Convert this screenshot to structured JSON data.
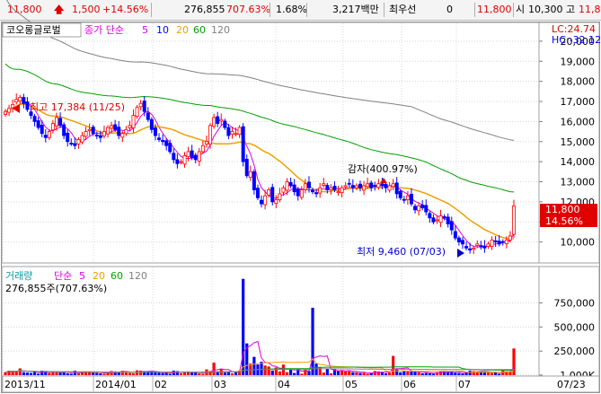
{
  "topbar": {
    "price": "11,800",
    "change": "1,500",
    "change_pct": "+14.56%",
    "volume": "276,855",
    "volume_pct": "707.63%",
    "turnover": "1.68%",
    "amount": "3,217백만",
    "pref_label": "최우선",
    "pref_value": "0",
    "pref_price": "11,800",
    "open_label": "시",
    "open_value": "10,300",
    "high_label": "고",
    "high_value": "11,8"
  },
  "colors": {
    "up": "#ff0000",
    "down": "#0000ff",
    "ma5": "#e000e0",
    "ma10": "#0000ff",
    "ma20": "#f0a000",
    "ma60": "#00a000",
    "ma120": "#808080"
  },
  "price_panel": {
    "stock_name": "코오롱글로벌",
    "ma_prefix": "종가 단순",
    "ma_periods": [
      "5",
      "10",
      "20",
      "60",
      "120"
    ],
    "lc_label": "LC:24.74",
    "hc_label": "HC:-32.12",
    "high_annotation": "최고 17,384 (11/25)",
    "low_annotation": "최저 9,460 (07/03)",
    "reduction_annotation": "감자(400.97%)",
    "current_price_tag": "11,800",
    "current_pct_tag": "14.56%",
    "y_ticks": [
      "20,000",
      "19,000",
      "18,000",
      "17,000",
      "16,000",
      "15,000",
      "14,000",
      "13,000",
      "12,000",
      "11,000",
      "10,000"
    ]
  },
  "volume_panel": {
    "title": "거래량",
    "ma_prefix": "단순",
    "ma_periods": [
      "5",
      "20",
      "60",
      "120"
    ],
    "summary": "276,855주(707.63%)",
    "y_ticks": [
      "1,000K",
      "750,000",
      "500,000",
      "250,000"
    ]
  },
  "x_axis": {
    "labels": [
      "2013/11",
      "2014/01",
      "02",
      "03",
      "04",
      "05",
      "06",
      "07",
      "07/23"
    ]
  },
  "chart_data": {
    "type": "candlestick",
    "price_range": [
      9000,
      20800
    ],
    "ma_keys": [
      "5",
      "20",
      "60",
      "120"
    ],
    "closes": [
      16500,
      16650,
      16850,
      17100,
      17200,
      16900,
      16600,
      16300,
      16000,
      15700,
      15400,
      15200,
      15500,
      15900,
      16200,
      15800,
      15300,
      15000,
      14900,
      14800,
      15100,
      15300,
      15500,
      15600,
      15400,
      15300,
      15200,
      15500,
      15700,
      15800,
      15600,
      15300,
      15400,
      15600,
      15800,
      16300,
      16700,
      16900,
      16500,
      16100,
      15600,
      15300,
      15100,
      15000,
      14800,
      14500,
      14100,
      13900,
      14000,
      14300,
      14500,
      14200,
      14100,
      14500,
      14800,
      15000,
      15800,
      16200,
      15900,
      16100,
      15700,
      15300,
      15500,
      15400,
      15700,
      14000,
      13300,
      13500,
      12600,
      12200,
      11900,
      12300,
      12600,
      12000,
      12100,
      12400,
      12700,
      13000,
      12800,
      12500,
      12300,
      12600,
      12900,
      12700,
      12500,
      12400,
      12700,
      12900,
      12600,
      12700,
      12600,
      12500,
      12700,
      12800,
      12900,
      12700,
      12800,
      12700,
      12800,
      12900,
      12700,
      12800,
      12900,
      12800,
      12700,
      12800,
      12900,
      12400,
      12200,
      12100,
      12300,
      11900,
      11600,
      11800,
      11700,
      11500,
      11200,
      11000,
      11100,
      11300,
      11200,
      10900,
      10600,
      10200,
      10000,
      9900,
      9700,
      9600,
      9700,
      9900,
      9800,
      9700,
      9900,
      10100,
      10000,
      9900,
      10000,
      10100,
      10300,
      11800
    ],
    "volume_bars": [
      {
        "i": 0,
        "v": 30000
      },
      {
        "i": 4,
        "v": 70000
      },
      {
        "i": 8,
        "v": 40000
      },
      {
        "i": 12,
        "v": 25000
      },
      {
        "i": 16,
        "v": 35000
      },
      {
        "i": 20,
        "v": 20000
      },
      {
        "i": 24,
        "v": 30000
      },
      {
        "i": 28,
        "v": 25000
      },
      {
        "i": 32,
        "v": 45000
      },
      {
        "i": 36,
        "v": 50000
      },
      {
        "i": 40,
        "v": 30000
      },
      {
        "i": 44,
        "v": 25000
      },
      {
        "i": 48,
        "v": 20000
      },
      {
        "i": 52,
        "v": 30000
      },
      {
        "i": 55,
        "v": 60000
      },
      {
        "i": 57,
        "v": 130000
      },
      {
        "i": 59,
        "v": 60000
      },
      {
        "i": 61,
        "v": 40000
      },
      {
        "i": 63,
        "v": 30000
      },
      {
        "i": 65,
        "v": 1000000
      },
      {
        "i": 66,
        "v": 330000
      },
      {
        "i": 67,
        "v": 120000
      },
      {
        "i": 68,
        "v": 190000
      },
      {
        "i": 69,
        "v": 110000
      },
      {
        "i": 70,
        "v": 140000
      },
      {
        "i": 71,
        "v": 100000
      },
      {
        "i": 72,
        "v": 90000
      },
      {
        "i": 74,
        "v": 80000
      },
      {
        "i": 76,
        "v": 110000
      },
      {
        "i": 78,
        "v": 60000
      },
      {
        "i": 80,
        "v": 70000
      },
      {
        "i": 82,
        "v": 60000
      },
      {
        "i": 84,
        "v": 700000
      },
      {
        "i": 85,
        "v": 120000
      },
      {
        "i": 86,
        "v": 80000
      },
      {
        "i": 88,
        "v": 70000
      },
      {
        "i": 90,
        "v": 60000
      },
      {
        "i": 92,
        "v": 50000
      },
      {
        "i": 94,
        "v": 40000
      },
      {
        "i": 96,
        "v": 30000
      },
      {
        "i": 98,
        "v": 25000
      },
      {
        "i": 100,
        "v": 20000
      },
      {
        "i": 104,
        "v": 20000
      },
      {
        "i": 106,
        "v": 200000
      },
      {
        "i": 107,
        "v": 60000
      },
      {
        "i": 108,
        "v": 30000
      },
      {
        "i": 110,
        "v": 40000
      },
      {
        "i": 114,
        "v": 20000
      },
      {
        "i": 118,
        "v": 30000
      },
      {
        "i": 122,
        "v": 40000
      },
      {
        "i": 126,
        "v": 30000
      },
      {
        "i": 130,
        "v": 40000
      },
      {
        "i": 134,
        "v": 30000
      },
      {
        "i": 137,
        "v": 40000
      },
      {
        "i": 139,
        "v": 276855
      }
    ],
    "volume_range": [
      0,
      1100000
    ]
  }
}
